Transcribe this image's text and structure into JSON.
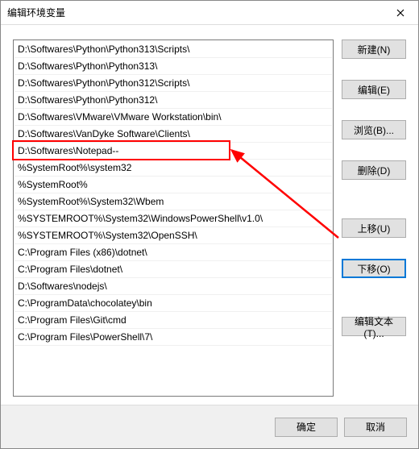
{
  "window": {
    "title": "编辑环境变量"
  },
  "paths": [
    "D:\\Softwares\\Python\\Python313\\Scripts\\",
    "D:\\Softwares\\Python\\Python313\\",
    "D:\\Softwares\\Python\\Python312\\Scripts\\",
    "D:\\Softwares\\Python\\Python312\\",
    "D:\\Softwares\\VMware\\VMware Workstation\\bin\\",
    "D:\\Softwares\\VanDyke Software\\Clients\\",
    "D:\\Softwares\\Notepad--",
    "%SystemRoot%\\system32",
    "%SystemRoot%",
    "%SystemRoot%\\System32\\Wbem",
    "%SYSTEMROOT%\\System32\\WindowsPowerShell\\v1.0\\",
    "%SYSTEMROOT%\\System32\\OpenSSH\\",
    "C:\\Program Files (x86)\\dotnet\\",
    "C:\\Program Files\\dotnet\\",
    "D:\\Softwares\\nodejs\\",
    "C:\\ProgramData\\chocolatey\\bin",
    "C:\\Program Files\\Git\\cmd",
    "C:\\Program Files\\PowerShell\\7\\"
  ],
  "buttons": {
    "new": "新建(N)",
    "edit": "编辑(E)",
    "browse": "浏览(B)...",
    "delete": "删除(D)",
    "move_up": "上移(U)",
    "move_down": "下移(O)",
    "edit_text": "编辑文本(T)...",
    "ok": "确定",
    "cancel": "取消"
  },
  "annotation": {
    "highlight_index": 6,
    "color": "#ff0000"
  }
}
